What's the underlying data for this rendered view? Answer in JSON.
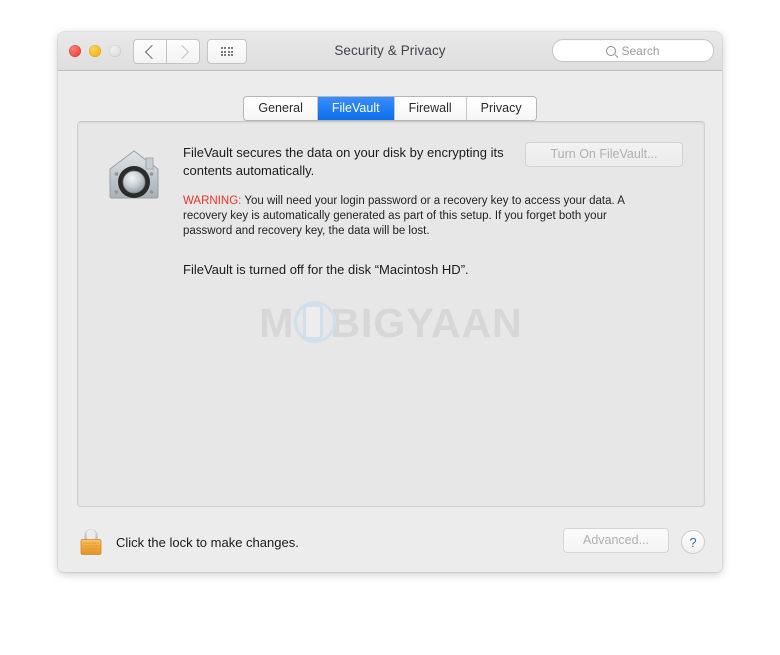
{
  "window": {
    "title": "Security & Privacy",
    "traffic_lights": [
      {
        "name": "close",
        "color": "#f4534a"
      },
      {
        "name": "minimize",
        "color": "#fbbd20"
      },
      {
        "name": "zoom",
        "color": "#e2e2e2"
      }
    ],
    "nav": {
      "back_icon": "chevron-left-icon",
      "forward_icon": "chevron-right-icon",
      "show_all_icon": "grid-icon"
    },
    "search": {
      "placeholder": "Search",
      "value": "",
      "icon": "search-icon"
    }
  },
  "tabs": [
    {
      "label": "General",
      "active": false
    },
    {
      "label": "FileVault",
      "active": true
    },
    {
      "label": "Firewall",
      "active": false
    },
    {
      "label": "Privacy",
      "active": false
    }
  ],
  "filevault": {
    "icon": "filevault-icon",
    "description": "FileVault secures the data on your disk by encrypting its contents automatically.",
    "turn_on_label": "Turn On FileVault...",
    "turn_on_enabled": false,
    "warning_label": "WARNING:",
    "warning_color": "#e8342a",
    "warning_text": " You will need your login password or a recovery key to access your data. A recovery key is automatically generated as part of this setup. If you forget both your password and recovery key, the data will be lost.",
    "status": "FileVault is turned off for the disk “Macintosh HD”."
  },
  "watermark": {
    "text_before": "M",
    "text_after": "BIGYAAN",
    "icon": "phone-icon",
    "color": "#d7d7d7"
  },
  "footer": {
    "lock_icon": "unlocked-padlock-icon",
    "lock_text": "Click the lock to make changes.",
    "advanced_label": "Advanced...",
    "advanced_enabled": false,
    "help_label": "?"
  }
}
